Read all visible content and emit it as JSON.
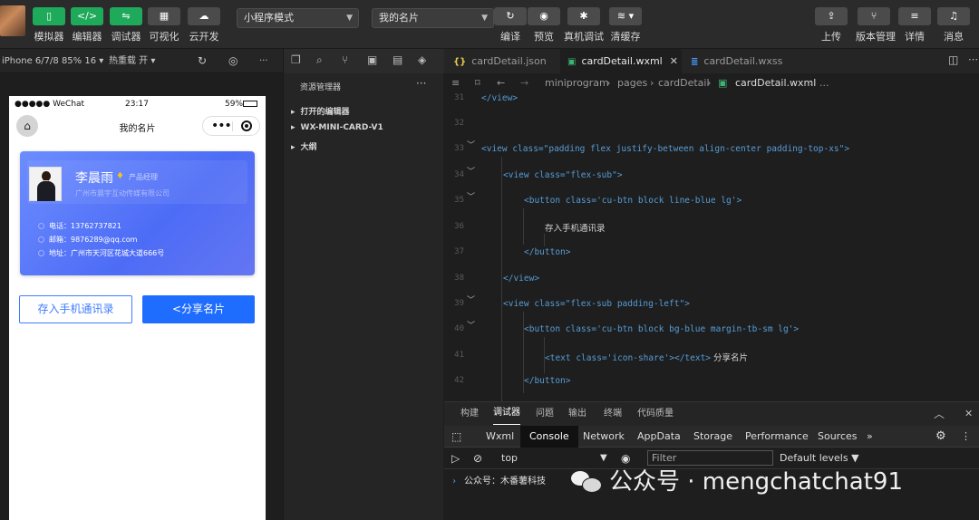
{
  "toolbar": {
    "left_buttons": [
      "模拟器",
      "编辑器",
      "调试器",
      "可视化",
      "云开发"
    ],
    "mode_select": "小程序模式",
    "page_select": "我的名片",
    "mid_buttons": [
      "编译",
      "预览",
      "真机调试",
      "清缓存"
    ],
    "right_buttons": [
      "上传",
      "版本管理",
      "详情",
      "消息"
    ]
  },
  "simulator_bar": {
    "device": "iPhone 6/7/8 85% 16 ▾",
    "hot_reload": "热重载 开 ▾",
    "more": "···"
  },
  "phone": {
    "carrier": "●●●●● WeChat",
    "time": "23:17",
    "battery": "59%",
    "nav_title": "我的名片",
    "card": {
      "name": "李晨雨",
      "title": "产品经理",
      "company": "广州市晨宇互动传媒有限公司",
      "phone": "电话：13762737821",
      "email": "邮箱：9876289@qq.com",
      "address": "地址：广州市天河区花城大道666号"
    },
    "save_button": "存入手机通讯录",
    "share_button": "分享名片"
  },
  "explorer": {
    "title": "资源管理器",
    "sections": [
      "打开的编辑器",
      "WX-MINI-CARD-V1",
      "大纲"
    ]
  },
  "editor": {
    "tabs": [
      "cardDetail.json",
      "cardDetail.wxml",
      "cardDetail.wxss"
    ],
    "breadcrumb": [
      "miniprogram",
      "pages",
      "cardDetail",
      "cardDetail.wxml",
      "..."
    ],
    "line_numbers": [
      "31",
      "32",
      "33",
      "34",
      "35",
      "36",
      "37",
      "38",
      "39",
      "40",
      "41",
      "42"
    ],
    "lines": {
      "l31": "</view>",
      "l33": "<view class=\"padding flex justify-between align-center padding-top-xs\">",
      "l34": "<view class=\"flex-sub\">",
      "l35": "<button class='cu-btn block line-blue lg'>",
      "l36": "存入手机通讯录",
      "l37": "</button>",
      "l38": "</view>",
      "l39": "<view class=\"flex-sub padding-left\">",
      "l40": "<button class='cu-btn block bg-blue margin-tb-sm lg'>",
      "l41a": "<text class='icon-share'></text>",
      "l41b": " 分享名片",
      "l42": "</button>"
    }
  },
  "panel": {
    "tabs": [
      "构建",
      "调试器",
      "问题",
      "输出",
      "终端",
      "代码质量"
    ],
    "devtools_tabs": [
      "Wxml",
      "Console",
      "Network",
      "AppData",
      "Storage",
      "Performance",
      "Sources",
      "»"
    ],
    "context": "top",
    "filter_placeholder": "Filter",
    "levels": "Default levels ▼",
    "console_line": "公众号：木番薯科技"
  },
  "watermark": "公众号 · mengchatchat91"
}
